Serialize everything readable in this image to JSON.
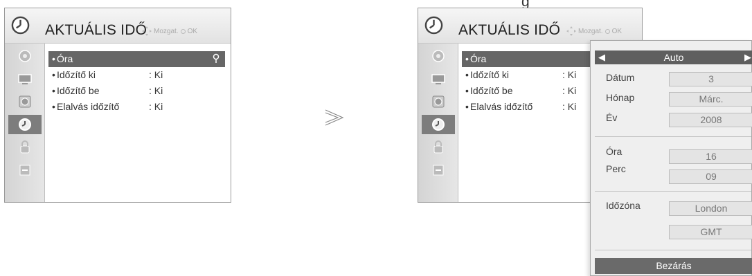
{
  "top_crop_text": "g",
  "left_menu": {
    "title": "AKTUÁLIS IDŐ",
    "hint": "Mozgat.",
    "ok": "OK",
    "items": [
      {
        "label": "Óra",
        "value": ""
      },
      {
        "label": "Időzítő ki",
        "value": ": Ki"
      },
      {
        "label": "Időzítő be",
        "value": ": Ki"
      },
      {
        "label": "Elalvás időzítő",
        "value": ": Ki"
      }
    ]
  },
  "right_menu": {
    "title": "AKTUÁLIS IDŐ",
    "hint": "Mozgat.",
    "ok": "OK",
    "items": [
      {
        "label": "Óra",
        "value": ""
      },
      {
        "label": "Időzítő ki",
        "value": ": Ki"
      },
      {
        "label": "Időzítő be",
        "value": ": Ki"
      },
      {
        "label": "Elalvás időzítő",
        "value": ": Ki"
      }
    ]
  },
  "sidebar_icons": [
    "setup-icon",
    "picture-icon",
    "audio-icon",
    "time-icon",
    "lock-icon",
    "input-icon"
  ],
  "active_sidebar_index": 3,
  "popup": {
    "mode": "Auto",
    "date_label": "Dátum",
    "date_value": "3",
    "month_label": "Hónap",
    "month_value": "Márc.",
    "year_label": "Év",
    "year_value": "2008",
    "hour_label": "Óra",
    "hour_value": "16",
    "minute_label": "Perc",
    "minute_value": "09",
    "timezone_label": "Időzóna",
    "timezone_value": "London",
    "timezone_offset": "GMT",
    "close_label": "Bezárás"
  },
  "colors": {
    "selected_row": "#666666",
    "sidebar_active": "#7d7d7d",
    "popup_bg": "#efefef"
  }
}
